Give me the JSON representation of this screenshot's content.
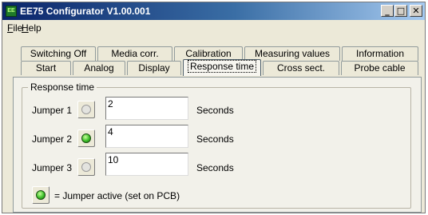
{
  "window": {
    "title": "EE75 Configurator V1.00.001",
    "app_icon_text": "EE",
    "minimize_glyph": "_",
    "maximize_glyph": "□",
    "close_glyph": "✕"
  },
  "menu": {
    "file": {
      "mnemonic": "F",
      "rest": "ile"
    },
    "help": {
      "mnemonic": "H",
      "rest": "elp"
    }
  },
  "tabs_row1": [
    {
      "label": "Switching Off"
    },
    {
      "label": "Media corr."
    },
    {
      "label": "Calibration"
    },
    {
      "label": "Measuring values"
    },
    {
      "label": "Information"
    }
  ],
  "tabs_row2": [
    {
      "label": "Start"
    },
    {
      "label": "Analog"
    },
    {
      "label": "Display"
    },
    {
      "label": "Response time",
      "active": true
    },
    {
      "label": "Cross sect."
    },
    {
      "label": "Probe cable"
    }
  ],
  "response_time": {
    "group_label": "Response time",
    "jumpers": [
      {
        "label": "Jumper 1",
        "active": false,
        "value": "2",
        "unit": "Seconds"
      },
      {
        "label": "Jumper 2",
        "active": true,
        "value": "4",
        "unit": "Seconds"
      },
      {
        "label": "Jumper 3",
        "active": false,
        "value": "10",
        "unit": "Seconds"
      }
    ],
    "legend": "= Jumper active (set on PCB)"
  }
}
